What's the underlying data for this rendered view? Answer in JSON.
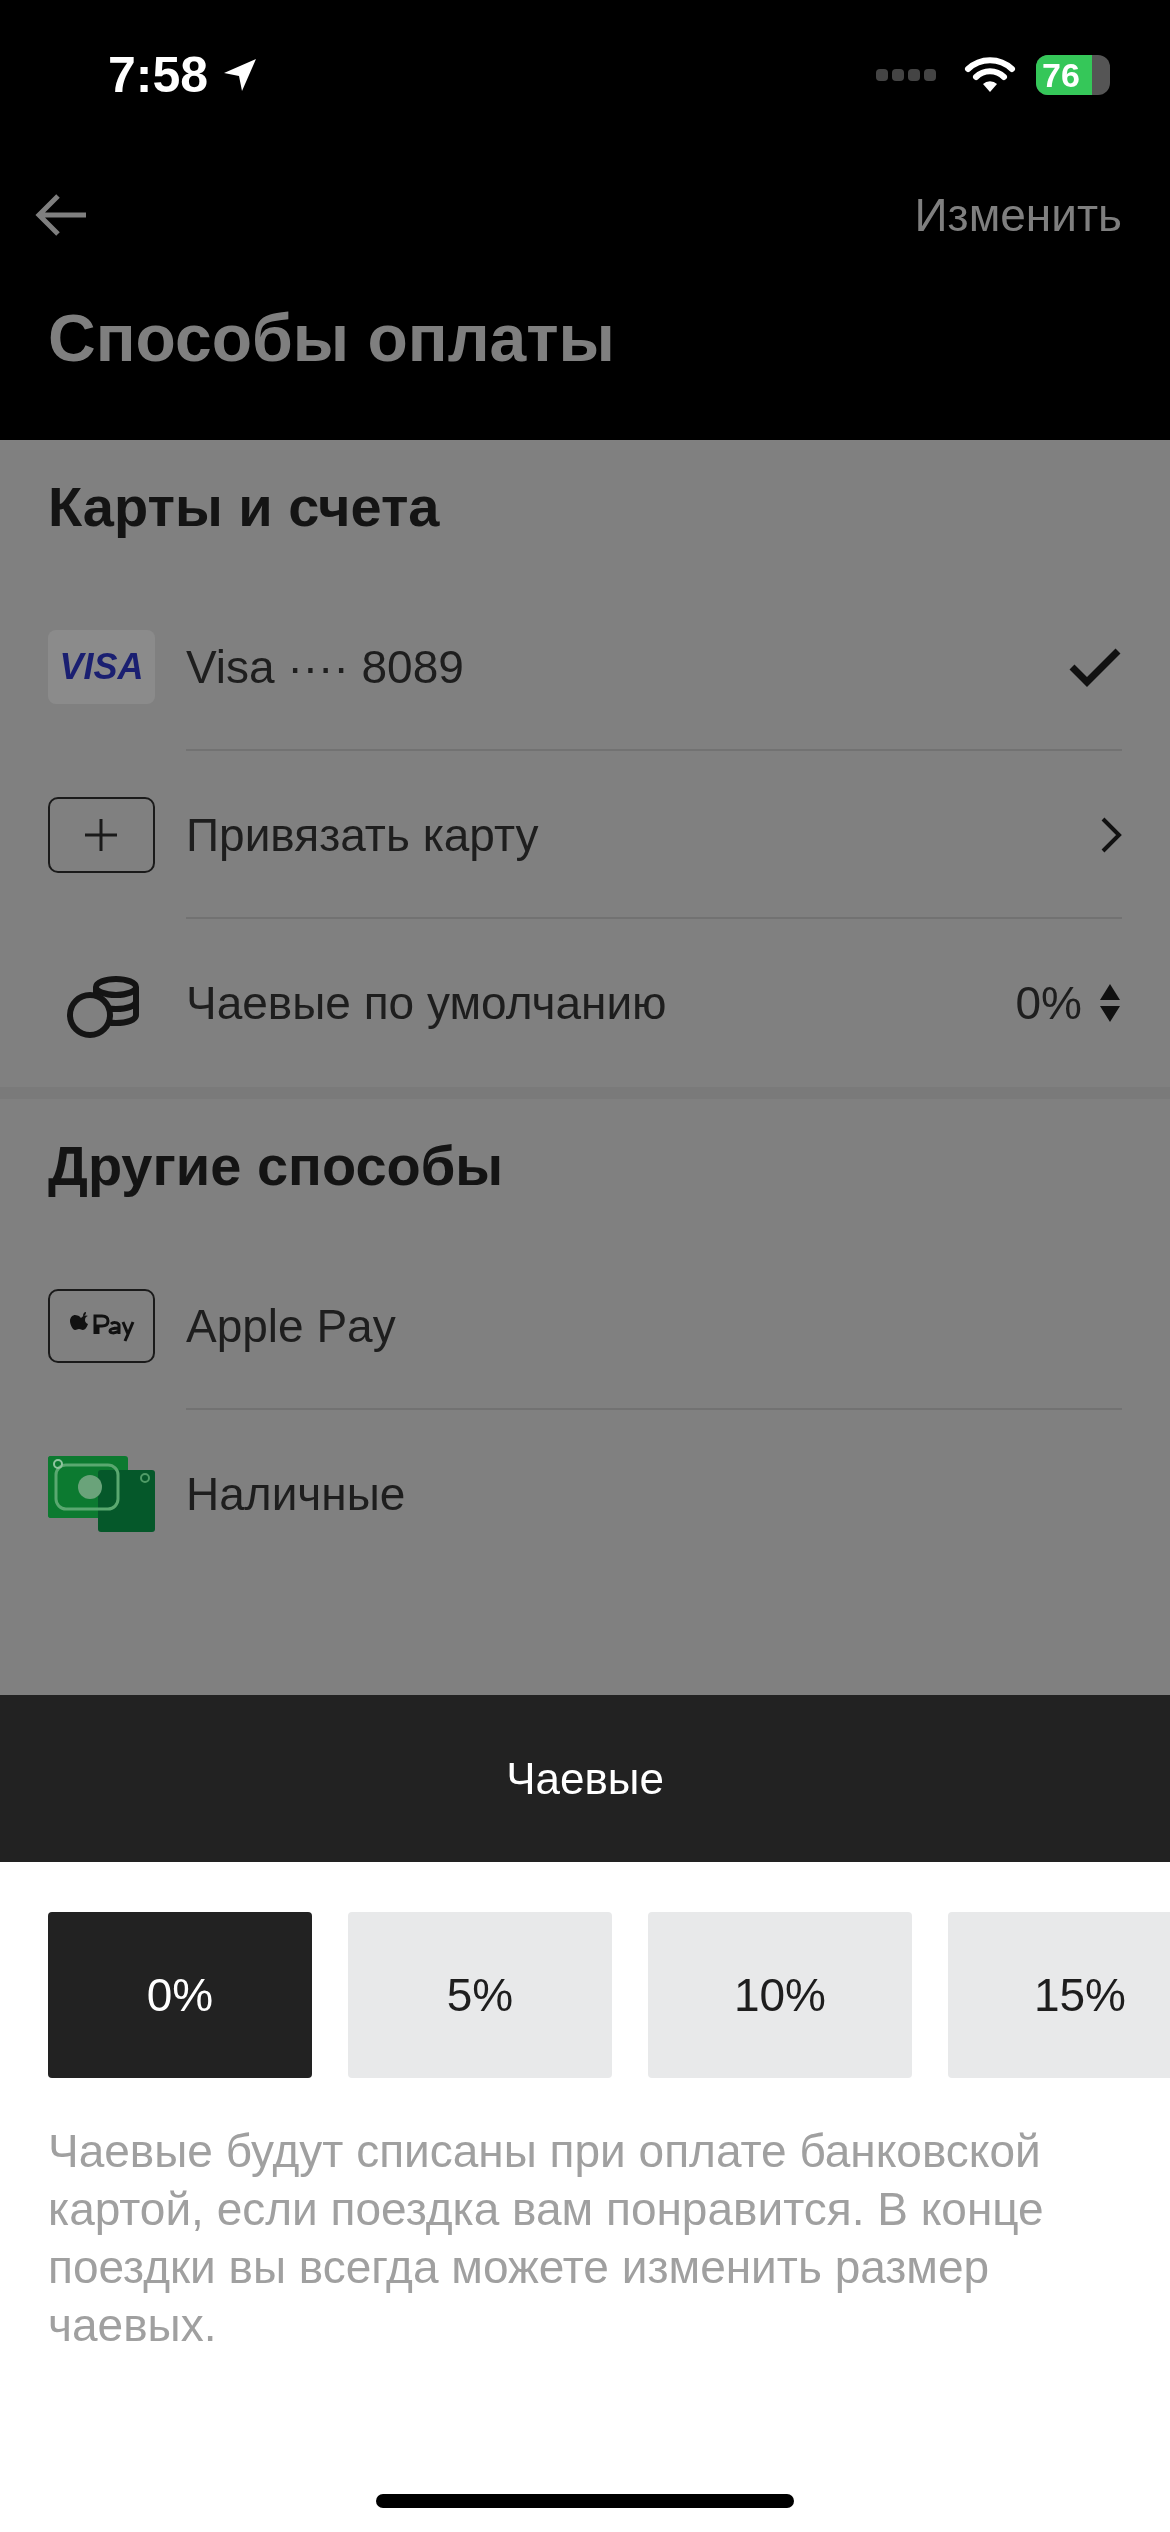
{
  "status_bar": {
    "time": "7:58",
    "battery": "76"
  },
  "nav": {
    "action": "Изменить"
  },
  "title": "Способы оплаты",
  "sections": [
    {
      "heading": "Карты и счета",
      "items": [
        {
          "kind": "visa",
          "logo": "VISA",
          "label": "Visa ···· 8089",
          "selected": true
        },
        {
          "kind": "add",
          "label": "Привязать карту",
          "selected": false
        },
        {
          "kind": "tips",
          "label": "Чаевые по умолчанию",
          "value": "0%",
          "selected": false
        }
      ]
    },
    {
      "heading": "Другие способы",
      "items": [
        {
          "kind": "applepay",
          "label": "Apple Pay",
          "selected": false
        },
        {
          "kind": "cash",
          "label": "Наличные",
          "selected": false
        }
      ]
    }
  ],
  "sheet": {
    "title": "Чаевые",
    "options": [
      {
        "label": "0%",
        "selected": true
      },
      {
        "label": "5%",
        "selected": false
      },
      {
        "label": "10%",
        "selected": false
      },
      {
        "label": "15%",
        "selected": false
      }
    ],
    "description": "Чаевые будут списаны при оплате банковской картой, если поездка вам понравится. В конце поездки вы всегда можете изменить размер чаевых."
  }
}
